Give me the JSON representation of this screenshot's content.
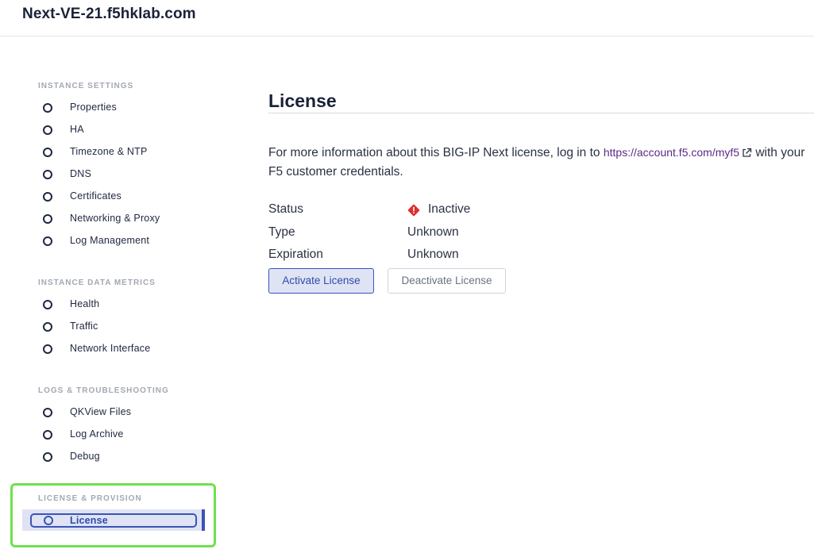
{
  "header": {
    "title": "Next-VE-21.f5hklab.com"
  },
  "sidebar": {
    "sections": [
      {
        "title": "INSTANCE SETTINGS",
        "items": [
          {
            "label": "Properties"
          },
          {
            "label": "HA"
          },
          {
            "label": "Timezone & NTP"
          },
          {
            "label": "DNS"
          },
          {
            "label": "Certificates"
          },
          {
            "label": "Networking & Proxy"
          },
          {
            "label": "Log Management"
          }
        ]
      },
      {
        "title": "INSTANCE DATA METRICS",
        "items": [
          {
            "label": "Health"
          },
          {
            "label": "Traffic"
          },
          {
            "label": "Network Interface"
          }
        ]
      },
      {
        "title": "LOGS & TROUBLESHOOTING",
        "items": [
          {
            "label": "QKView Files"
          },
          {
            "label": "Log Archive"
          },
          {
            "label": "Debug"
          }
        ]
      },
      {
        "title": "LICENSE & PROVISION",
        "items": [
          {
            "label": "License",
            "active": true
          }
        ]
      }
    ]
  },
  "main": {
    "title": "License",
    "info": {
      "prefix": "For more information about this BIG-IP Next license, log in to ",
      "link_text": "https://account.f5.com/myf5",
      "suffix": " with your F5 customer credentials."
    },
    "fields": {
      "status_label": "Status",
      "status_value": "Inactive",
      "status_color": "#e02d2d",
      "type_label": "Type",
      "type_value": "Unknown",
      "expiration_label": "Expiration",
      "expiration_value": "Unknown"
    },
    "buttons": {
      "activate": "Activate License",
      "deactivate": "Deactivate License"
    }
  },
  "colors": {
    "accent": "#3a54b8",
    "focus_outline": "#6ee14e",
    "link": "#5b2a86"
  }
}
